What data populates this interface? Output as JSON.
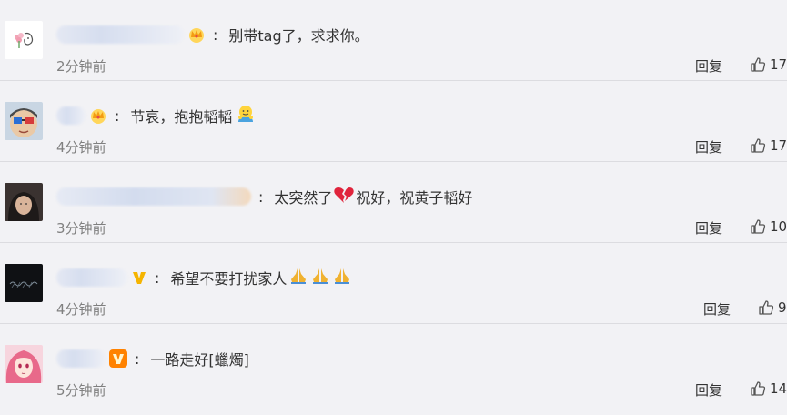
{
  "comments": [
    {
      "badge": "crown",
      "text_parts": [
        "别带tag了，求求你。"
      ],
      "time": "2分钟前",
      "reply_label": "回复",
      "likes": "17"
    },
    {
      "badge": "crown",
      "text_parts": [
        "节哀，抱抱韬韬"
      ],
      "emoji_after": "hug-emoji",
      "time": "4分钟前",
      "reply_label": "回复",
      "likes": "17"
    },
    {
      "badge": "none",
      "text_parts": [
        "太突然了",
        "祝好，祝黄子韬好"
      ],
      "emoji_mid": "broken-heart-emoji",
      "time": "3分钟前",
      "reply_label": "回复",
      "likes": "10"
    },
    {
      "badge": "v-yellow",
      "text_parts": [
        "希望不要打扰家人"
      ],
      "emoji_after": "pray-emoji x3",
      "time": "4分钟前",
      "reply_label": "回复",
      "likes": "9"
    },
    {
      "badge": "v-orange",
      "text_parts": [
        "一路走好[蠟燭]"
      ],
      "time": "5分钟前",
      "reply_label": "回复",
      "likes": "14"
    }
  ],
  "colors": {
    "background": "#f2f2f5",
    "divider": "#dcdce0",
    "time_text": "#808080",
    "crown_gold": "#f5a623",
    "v_badge_orange": "#ff8200"
  }
}
